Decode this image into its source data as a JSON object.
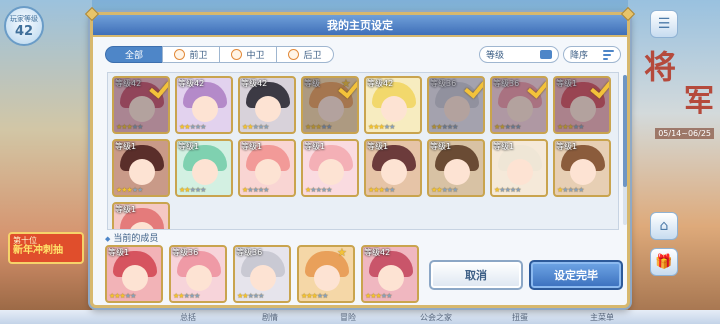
{
  "background": {
    "player_level_label": "玩家等级",
    "player_level": "42",
    "banner_line1": "第十位",
    "banner_line2": "新年冲刺抽",
    "right_title": "将",
    "right_sub": "军",
    "right_date": "05/14~06/25",
    "nav": [
      "总括",
      "剧情",
      "冒险",
      "公会之家",
      "扭蛋",
      "主菜单"
    ]
  },
  "dialog": {
    "title": "我的主页设定",
    "filters": [
      {
        "label": "全部",
        "active": true
      },
      {
        "label": "前卫",
        "active": false
      },
      {
        "label": "中卫",
        "active": false
      },
      {
        "label": "后卫",
        "active": false
      }
    ],
    "sort_level_label": "等级",
    "sort_order_label": "降序",
    "current_members_label": "当前的成员",
    "cancel_label": "取消",
    "confirm_label": "设定完毕",
    "roster": [
      {
        "level": "等级42",
        "stars": 3,
        "selected": true,
        "hair": "#c9556a",
        "bg": "#f0b7c0"
      },
      {
        "level": "等级42",
        "stars": 2,
        "selected": false,
        "hair": "#b48ac9",
        "bg": "#e2d2ee"
      },
      {
        "level": "等级42",
        "stars": 2,
        "selected": false,
        "hair": "#3c3a44",
        "bg": "#d8d2da"
      },
      {
        "level": "等级",
        "stars": 3,
        "selected": true,
        "star_badge": true,
        "hair": "#e9a05a",
        "bg": "#f5d7a7"
      },
      {
        "level": "等级42",
        "stars": 3,
        "selected": false,
        "hair": "#f2d86c",
        "bg": "#f7ecc0"
      },
      {
        "level": "等级36",
        "stars": 2,
        "selected": true,
        "hair": "#c9c9d3",
        "bg": "#e6e4ec"
      },
      {
        "level": "等级36",
        "stars": 2,
        "selected": true,
        "hair": "#ef9aa6",
        "bg": "#f7d4da"
      },
      {
        "level": "等级1",
        "stars": 3,
        "selected": true,
        "hair": "#d6545f",
        "bg": "#f2b3b7"
      },
      {
        "level": "等级1",
        "stars": 3,
        "selected": false,
        "hair": "#5a2e2a",
        "bg": "#c99a88"
      },
      {
        "level": "等级1",
        "stars": 2,
        "selected": false,
        "hair": "#7fd1b0",
        "bg": "#d3f0e2"
      },
      {
        "level": "等级1",
        "stars": 1,
        "selected": false,
        "hair": "#f29a98",
        "bg": "#f9d5d3"
      },
      {
        "level": "等级1",
        "stars": 1,
        "selected": false,
        "hair": "#f4b0b6",
        "bg": "#fadbe0"
      },
      {
        "level": "等级1",
        "stars": 3,
        "selected": false,
        "hair": "#6c3b3b",
        "bg": "#e6c4a7"
      },
      {
        "level": "等级1",
        "stars": 2,
        "selected": false,
        "hair": "#6a4b34",
        "bg": "#d8c2a4"
      },
      {
        "level": "等级1",
        "stars": 1,
        "selected": false,
        "hair": "#efe6d6",
        "bg": "#f5e9d9"
      },
      {
        "level": "等级1",
        "stars": 1,
        "selected": false,
        "hair": "#8b5c3c",
        "bg": "#e7cfb4"
      },
      {
        "level": "等级1",
        "stars": 1,
        "selected": false,
        "hair": "#e47b7b",
        "bg": "#f5c8c4"
      }
    ],
    "current": [
      {
        "level": "等级1",
        "stars": 3,
        "hair": "#d6545f",
        "bg": "#f2b3b7"
      },
      {
        "level": "等级36",
        "stars": 2,
        "hair": "#ef9aa6",
        "bg": "#f7d4da"
      },
      {
        "level": "等级36",
        "stars": 2,
        "hair": "#c9c9d3",
        "bg": "#e6e4ec"
      },
      {
        "level": "",
        "stars": 3,
        "star_badge": true,
        "hair": "#e9a05a",
        "bg": "#f5d7a7"
      },
      {
        "level": "等级42",
        "stars": 3,
        "hair": "#c9556a",
        "bg": "#f0b7c0"
      }
    ]
  }
}
